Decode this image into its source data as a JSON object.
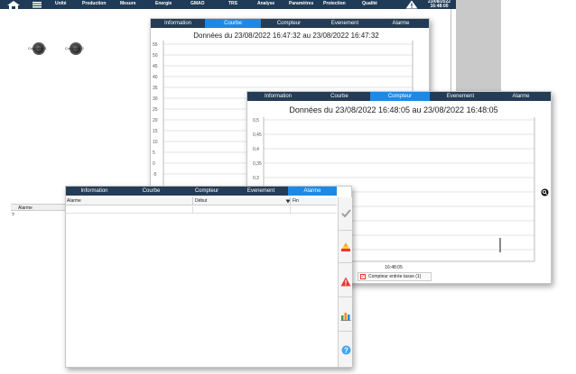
{
  "navbar": {
    "items": [
      "Unité",
      "Production",
      "Mesure",
      "Energie",
      "GMAO",
      "TRS",
      "Analyse",
      "Paramètres",
      "Protection",
      "Qualité"
    ],
    "date": "23/08/2022",
    "time": "16:48:00"
  },
  "background": {
    "knobs": [
      {
        "label": "Compteur 1"
      },
      {
        "label": "Compteur 2"
      }
    ],
    "alarm_header": "Alarme",
    "alarm_row": "?"
  },
  "window1": {
    "tabs": [
      "Information",
      "Courbe",
      "Compteur",
      "Evenement",
      "Alarme"
    ],
    "active_tab": 1,
    "title": "Données du 23/08/2022 16:47:32 au 23/08/2022 16:47:32",
    "yticks": [
      "55",
      "50",
      "45",
      "40",
      "35",
      "30",
      "25",
      "20",
      "15",
      "10",
      "5",
      "0",
      "-5"
    ]
  },
  "window2": {
    "tabs": [
      "Information",
      "Courbe",
      "Compteur",
      "Evenement",
      "Alarme"
    ],
    "active_tab": 2,
    "title": "Données du 23/08/2022 16:48:05 au 23/08/2022 16:48:05",
    "yticks": [
      "0,5",
      "0,45",
      "0,4",
      "0,35",
      "0,3"
    ],
    "xtick": "16:48:05",
    "legend": "Compteur entrée tasse (1)"
  },
  "window3": {
    "tabs": [
      "Information",
      "Courbe",
      "Compteur",
      "Evenement",
      "Alarme"
    ],
    "active_tab": 4,
    "columns": [
      "Alarme",
      "Début",
      "Fin"
    ],
    "sidebar_icons": [
      "check-icon",
      "triangle-stack-icon",
      "warning-icon",
      "bar-chart-icon",
      "help-icon"
    ]
  },
  "colors": {
    "navbar": "#1f3b57",
    "tabbar": "#243c55",
    "tab_active": "#1e88e5"
  }
}
